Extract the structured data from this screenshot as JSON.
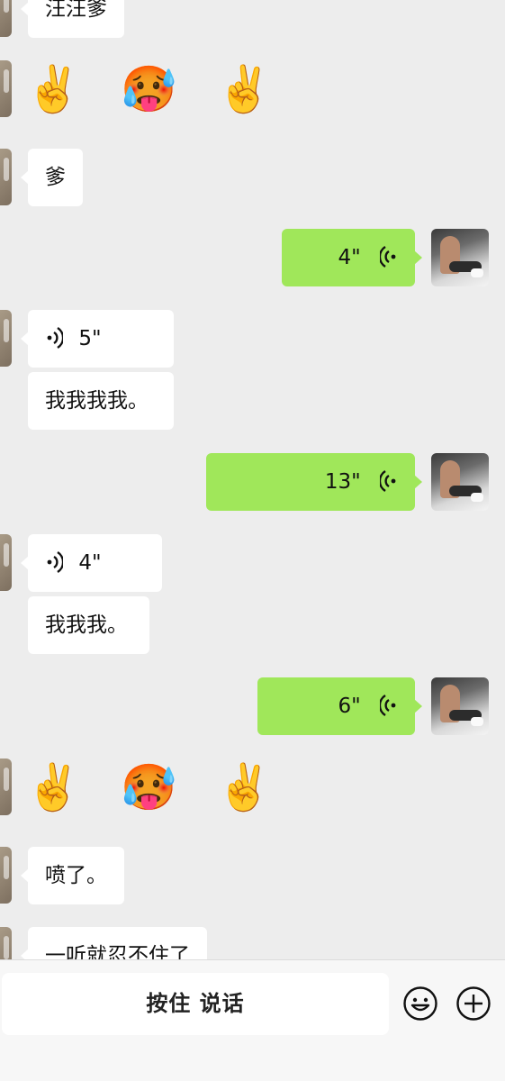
{
  "messages": {
    "m1": {
      "text": "汪汪爹"
    },
    "m2": {
      "emoji": "✌️ 🥵 ✌️"
    },
    "m3": {
      "text": "爹"
    },
    "m4": {
      "duration": "4\""
    },
    "m5": {
      "duration": "5\""
    },
    "m6": {
      "text": "我我我我。"
    },
    "m7": {
      "duration": "13\""
    },
    "m8": {
      "duration": "4\""
    },
    "m9": {
      "text": "我我我。"
    },
    "m10": {
      "duration": "6\""
    },
    "m11": {
      "emoji": "✌️ 🥵 ✌️"
    },
    "m12": {
      "text": "喷了。"
    },
    "m13": {
      "text": "一听就忍不住了"
    }
  },
  "input_bar": {
    "hold_to_talk_label": "按住 说话",
    "emoji_icon": "emoji-icon",
    "plus_icon": "plus-icon"
  },
  "colors": {
    "background": "#ededed",
    "received_bubble": "#ffffff",
    "sent_bubble": "#a0e75a",
    "input_bar": "#f7f7f7"
  }
}
